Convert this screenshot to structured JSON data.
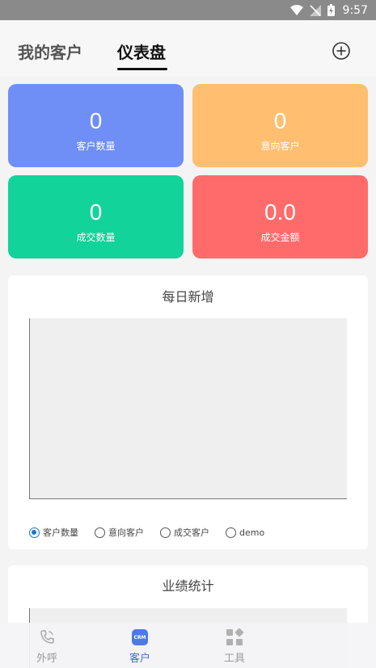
{
  "status_bar": {
    "time": "9:57"
  },
  "header": {
    "tabs": [
      {
        "label": "我的客户",
        "active": false
      },
      {
        "label": "仪表盘",
        "active": true
      }
    ]
  },
  "stats": [
    {
      "value": "0",
      "label": "客户数量",
      "color": "#6f8ff7"
    },
    {
      "value": "0",
      "label": "意向客户",
      "color": "#ffbe70"
    },
    {
      "value": "0",
      "label": "成交数量",
      "color": "#12d399"
    },
    {
      "value": "0.0",
      "label": "成交金额",
      "color": "#ff6b6b"
    }
  ],
  "daily_panel": {
    "title": "每日新增",
    "options": [
      "客户数量",
      "意向客户",
      "成交客户",
      "demo"
    ],
    "selected": "客户数量"
  },
  "performance_panel": {
    "title": "业绩统计"
  },
  "bottom_nav": [
    {
      "label": "外呼",
      "icon": "phone-icon",
      "active": false
    },
    {
      "label": "客户",
      "icon": "crm-icon",
      "badge": "CRM",
      "active": true
    },
    {
      "label": "工具",
      "icon": "tools-icon",
      "active": false
    }
  ],
  "colors": {
    "accent": "#3f6bd8",
    "radio_selected": "#1976d2"
  }
}
